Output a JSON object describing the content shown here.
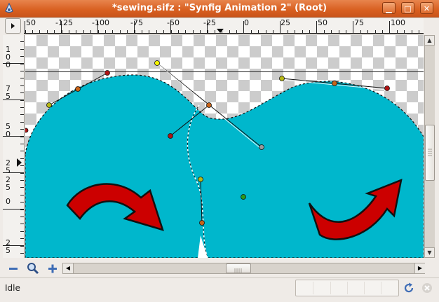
{
  "window": {
    "title": "*sewing.sifz : \"Synfig Animation 2\" (Root)",
    "buttons": {
      "minimize": "▁",
      "maximize": "□",
      "close": "✕"
    }
  },
  "rulers": {
    "horizontal_labels": [
      "50",
      "-125",
      "-100",
      "-75",
      "-50",
      "-25",
      "0",
      "25",
      "50",
      "75",
      "100"
    ],
    "vertical_labels": [
      "1",
      "0",
      "0",
      "7",
      "5",
      "5",
      "0",
      "2",
      "5",
      "2",
      "5",
      "0",
      "2",
      "5"
    ]
  },
  "canvas": {
    "fill_color": "#00b7cc",
    "arrow_color": "#cc0000",
    "duck_colors": {
      "orange": "#c8641a",
      "red": "#b01414",
      "yellow_green": "#b8b814",
      "yellow": "#f4f400",
      "green": "#2a9a1a",
      "gray": "#9a9a9a"
    }
  },
  "toolbar": {
    "zoom_out_icon": "minus-icon",
    "zoom_fit_icon": "magnifier-icon",
    "zoom_in_icon": "plus-icon"
  },
  "statusbar": {
    "status_text": "Idle",
    "refresh_icon": "refresh-icon",
    "stop_icon": "stop-icon"
  }
}
